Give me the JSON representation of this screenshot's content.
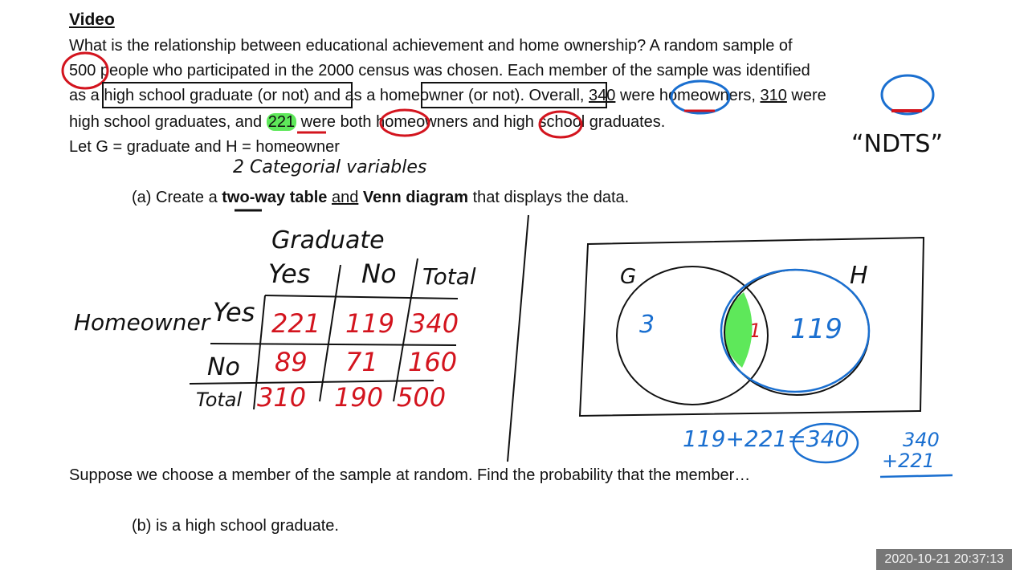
{
  "document": {
    "title": "Video",
    "paragraph": {
      "line1": "What is the relationship between educational achievement and home ownership?  A random sample of",
      "line2_num": "500",
      "line2_rest": " people who participated in the 2000 census was chosen.  Each member of the sample was identified",
      "line3_a": "as a ",
      "line3_box1": "high school graduate (or not)",
      "line3_b": " and as a ",
      "line3_box2": "homeowner (or not).",
      "line3_c": "  Overall, ",
      "line3_num1": "340",
      "line3_d": " were homeowners, ",
      "line3_num2": "310",
      "line3_e": " were",
      "line4_a": "high school graduates, and ",
      "line4_num": "221",
      "line4_b": " were ",
      "line4_both": "both",
      "line4_c": " homeowners ",
      "line4_and": "and",
      "line4_d": " high school graduates.",
      "line5": "Let G = graduate and H = homeowner"
    },
    "part_a": {
      "prefix": "(a) Create a ",
      "bold1": "two-way table",
      "mid": " ",
      "and": "and",
      "bold2": " Venn diagram",
      "suffix": " that displays the data."
    },
    "question": "Suppose we choose a member of the sample at random.  Find the probability that the member…",
    "part_b": "(b) is a high school graduate."
  },
  "annotations": {
    "ndts": "“NDTS”",
    "categorical": "2 Categorial variables",
    "table": {
      "column_group": "Graduate",
      "row_group": "Homeowner",
      "columns": [
        "Yes",
        "No",
        "Total"
      ],
      "rows": [
        {
          "label": "Yes",
          "values": [
            "221",
            "119",
            "340"
          ]
        },
        {
          "label": "No",
          "values": [
            "89",
            "71",
            "160"
          ]
        },
        {
          "label": "Total",
          "values": [
            "310",
            "190",
            "500"
          ]
        }
      ]
    },
    "venn": {
      "set_g": "G",
      "set_h": "H",
      "g_only": "3",
      "both": "221",
      "h_only": "119"
    },
    "work": {
      "sum": "119+221=340",
      "stack_top": "340",
      "stack_bottom": "+221"
    }
  },
  "colors": {
    "red_ink": "#d3141e",
    "blue_ink": "#1a6fd0",
    "highlight": "#5ee85a"
  },
  "timestamp": "2020-10-21  20:37:13"
}
